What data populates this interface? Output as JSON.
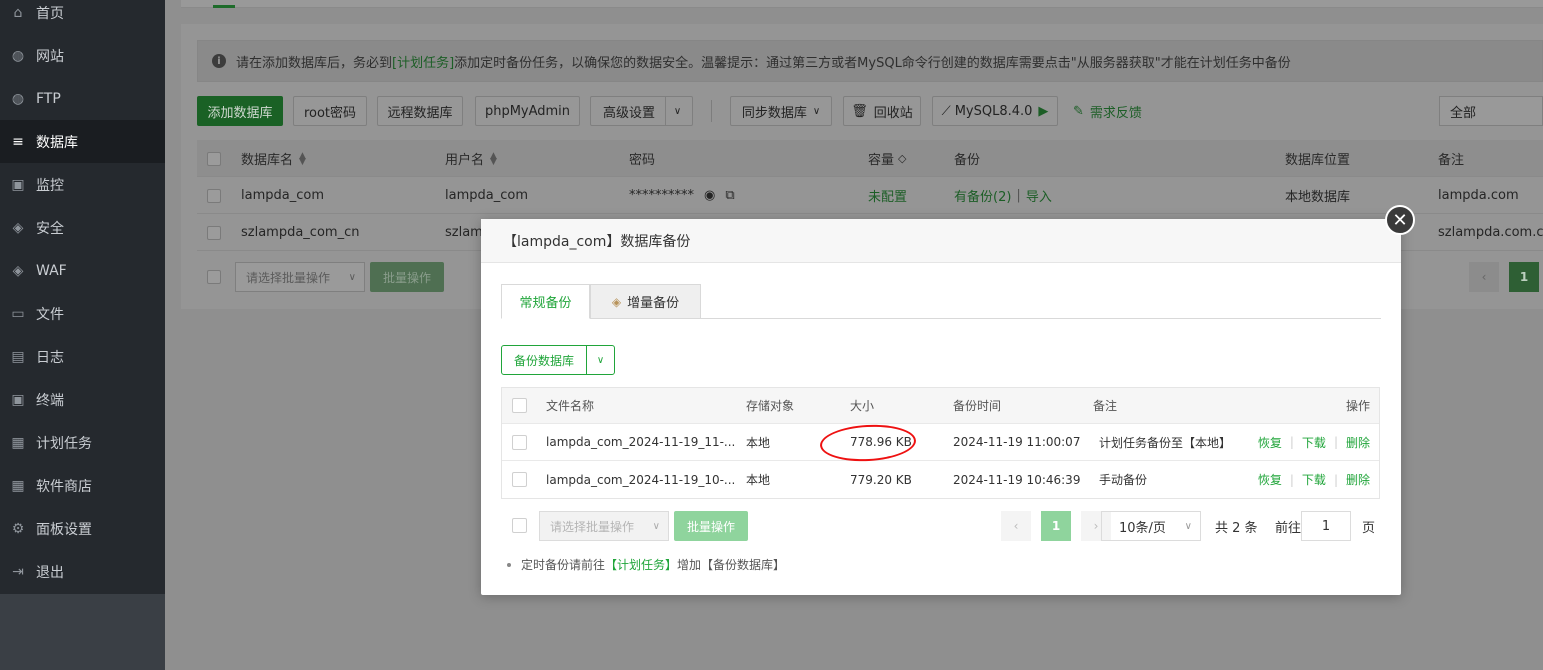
{
  "sidebar": {
    "items": [
      {
        "label": "首页",
        "icon": "home-icon",
        "glyph": "⌂"
      },
      {
        "label": "网站",
        "icon": "globe-icon",
        "glyph": "◍"
      },
      {
        "label": "FTP",
        "icon": "ftp-globe-icon",
        "glyph": "◍"
      },
      {
        "label": "数据库",
        "icon": "database-icon",
        "glyph": "≡"
      },
      {
        "label": "监控",
        "icon": "monitor-icon",
        "glyph": "▣"
      },
      {
        "label": "安全",
        "icon": "shield-icon",
        "glyph": "◈"
      },
      {
        "label": "WAF",
        "icon": "waf-shield-icon",
        "glyph": "◈"
      },
      {
        "label": "文件",
        "icon": "folder-icon",
        "glyph": "▭"
      },
      {
        "label": "日志",
        "icon": "log-icon",
        "glyph": "▤"
      },
      {
        "label": "终端",
        "icon": "terminal-icon",
        "glyph": "▣"
      },
      {
        "label": "计划任务",
        "icon": "calendar-icon",
        "glyph": "▦"
      },
      {
        "label": "软件商店",
        "icon": "apps-icon",
        "glyph": "▦"
      },
      {
        "label": "面板设置",
        "icon": "gear-icon",
        "glyph": "⚙"
      },
      {
        "label": "退出",
        "icon": "logout-icon",
        "glyph": "⇥"
      }
    ],
    "active_index": 3
  },
  "notice": {
    "text_before": "请在添加数据库后，务必到",
    "link": "[计划任务]",
    "text_after": "添加定时备份任务，以确保您的数据安全。温馨提示：通过第三方或者MySQL命令行创建的数据库需要点击\"从服务器获取\"才能在计划任务中备份"
  },
  "toolbar": {
    "add_db": "添加数据库",
    "root_pwd": "root密码",
    "remote_db": "远程数据库",
    "phpmyadmin": "phpMyAdmin",
    "advanced": "高级设置",
    "sync_db": "同步数据库",
    "recycle": "回收站",
    "mysql_version": "MySQL8.4.0",
    "feedback": "需求反馈",
    "filter_all": "全部"
  },
  "db_table": {
    "headers": {
      "name": "数据库名",
      "user": "用户名",
      "password": "密码",
      "capacity": "容量",
      "backup": "备份",
      "location": "数据库位置",
      "remark": "备注"
    },
    "rows": [
      {
        "name": "lampda_com",
        "user": "lampda_com",
        "password": "**********",
        "capacity": "未配置",
        "backup": "有备份(2)",
        "import": "导入",
        "location": "本地数据库",
        "remark": "lampda.com"
      },
      {
        "name": "szlampda_com_cn",
        "user": "szlam",
        "remark": "szlampda.com.cn"
      }
    ],
    "batch_placeholder": "请选择批量操作",
    "batch_button": "批量操作",
    "page_current": "1",
    "page_prev": "‹"
  },
  "modal": {
    "title": "【lampda_com】数据库备份",
    "close": "✕",
    "tabs": [
      {
        "label": "常规备份"
      },
      {
        "label": "增量备份"
      }
    ],
    "backup_button": "备份数据库",
    "table": {
      "headers": {
        "file": "文件名称",
        "storage": "存储对象",
        "size": "大小",
        "time": "备份时间",
        "remark": "备注",
        "actions": "操作"
      },
      "rows": [
        {
          "file": "lampda_com_2024-11-19_11-...",
          "storage": "本地",
          "size": "778.96 KB",
          "time": "2024-11-19 11:00:07",
          "remark": "计划任务备份至【本地】",
          "restore": "恢复",
          "download": "下载",
          "delete": "删除"
        },
        {
          "file": "lampda_com_2024-11-19_10-...",
          "storage": "本地",
          "size": "779.20 KB",
          "time": "2024-11-19 10:46:39",
          "remark": "手动备份",
          "restore": "恢复",
          "download": "下载",
          "delete": "删除"
        }
      ]
    },
    "pagination": {
      "batch_placeholder": "请选择批量操作",
      "batch_button": "批量操作",
      "prev": "‹",
      "current": "1",
      "next": "›",
      "per_page": "10条/页",
      "total": "共 2 条",
      "goto_label": "前往",
      "goto_value": "1",
      "page_unit": "页"
    },
    "tip": {
      "before": "定时备份请前往",
      "link": "【计划任务】",
      "after": "增加【备份数据库】"
    }
  },
  "colors": {
    "accent": "#20a53a",
    "highlight_ring": "#ee1111"
  }
}
